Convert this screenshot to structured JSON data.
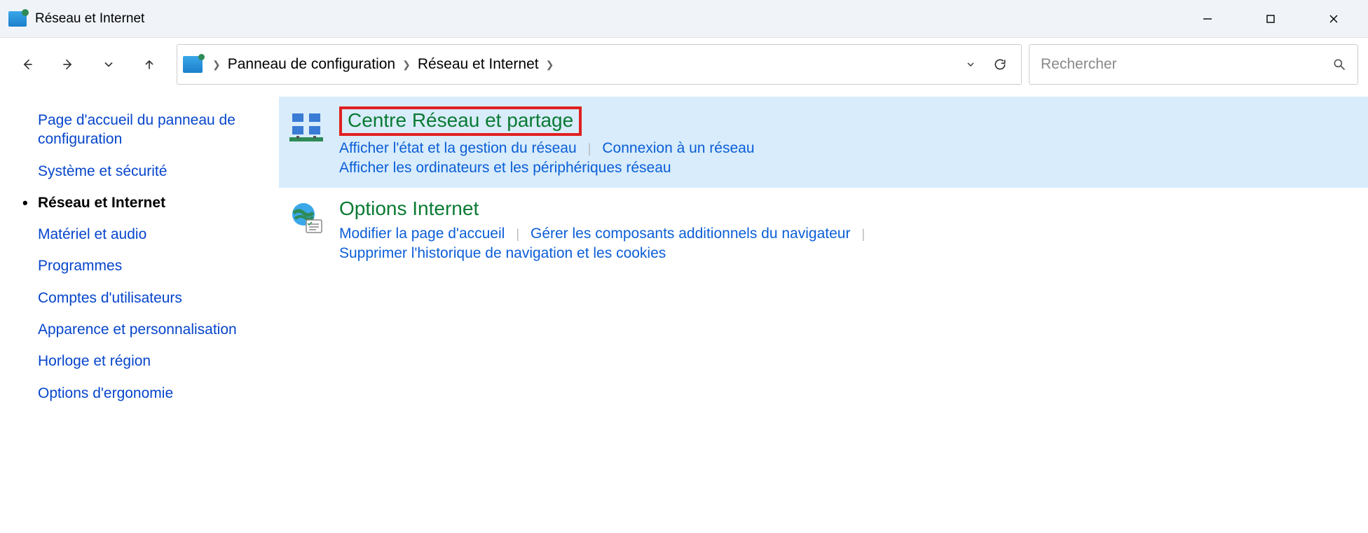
{
  "window": {
    "title": "Réseau et Internet"
  },
  "breadcrumb": {
    "items": [
      "Panneau de configuration",
      "Réseau et Internet"
    ]
  },
  "search": {
    "placeholder": "Rechercher"
  },
  "sidebar": {
    "items": [
      {
        "label": "Page d'accueil du panneau de configuration",
        "current": false
      },
      {
        "label": "Système et sécurité",
        "current": false
      },
      {
        "label": "Réseau et Internet",
        "current": true
      },
      {
        "label": "Matériel et audio",
        "current": false
      },
      {
        "label": "Programmes",
        "current": false
      },
      {
        "label": "Comptes d'utilisateurs",
        "current": false
      },
      {
        "label": "Apparence et personnalisation",
        "current": false
      },
      {
        "label": "Horloge et région",
        "current": false
      },
      {
        "label": "Options d'ergonomie",
        "current": false
      }
    ]
  },
  "categories": [
    {
      "title": "Centre Réseau et partage",
      "highlighted": true,
      "annotated": true,
      "links": [
        "Afficher l'état et la gestion du réseau",
        "Connexion à un réseau",
        "Afficher les ordinateurs et les périphériques réseau"
      ]
    },
    {
      "title": "Options Internet",
      "highlighted": false,
      "annotated": false,
      "links": [
        "Modifier la page d'accueil",
        "Gérer les composants additionnels du navigateur",
        "Supprimer l'historique de navigation et les cookies"
      ]
    }
  ]
}
